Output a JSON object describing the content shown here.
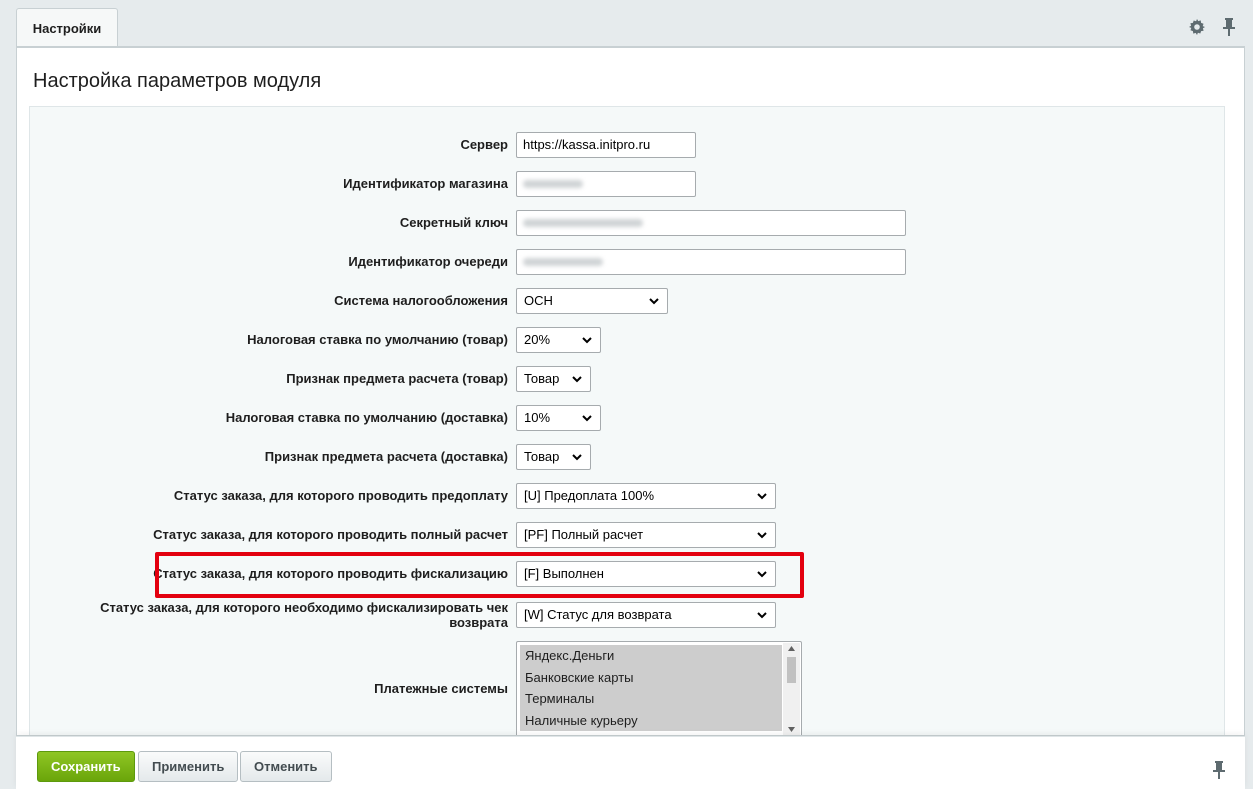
{
  "tab": {
    "label": "Настройки"
  },
  "top_icons": [
    "gear-icon",
    "pin-icon"
  ],
  "title": "Настройка параметров модуля",
  "fields": {
    "server": {
      "label": "Сервер",
      "value": "https://kassa.initpro.ru"
    },
    "shop_id": {
      "label": "Идентификатор магазина"
    },
    "secret_key": {
      "label": "Секретный ключ"
    },
    "queue_id": {
      "label": "Идентификатор очереди"
    },
    "tax_system": {
      "label": "Система налогообложения",
      "value": "ОСН"
    },
    "tax_rate_item": {
      "label": "Налоговая ставка по умолчанию (товар)",
      "value": "20%"
    },
    "subject_item": {
      "label": "Признак предмета расчета (товар)",
      "value": "Товар"
    },
    "tax_rate_delivery": {
      "label": "Налоговая ставка по умолчанию (доставка)",
      "value": "10%"
    },
    "subject_delivery": {
      "label": "Признак предмета расчета (доставка)",
      "value": "Товар"
    },
    "status_prepay": {
      "label": "Статус заказа, для которого проводить предоплату",
      "value": "[U] Предоплата 100%"
    },
    "status_full": {
      "label": "Статус заказа, для которого проводить полный расчет",
      "value": "[PF] Полный расчет"
    },
    "status_fiscal": {
      "label": "Статус заказа, для которого проводить фискализацию",
      "value": "[F] Выполнен"
    },
    "status_return": {
      "label_line1": "Статус заказа, для которого необходимо фискализировать чек",
      "label_line2": "возврата",
      "value": "[W] Статус для возврата"
    },
    "payment_systems": {
      "label": "Платежные системы",
      "options": [
        "Яндекс.Деньги",
        "Банковские карты",
        "Терминалы",
        "Наличные курьеру"
      ]
    }
  },
  "buttons": {
    "save": "Сохранить",
    "apply": "Применить",
    "cancel": "Отменить"
  },
  "colors": {
    "highlight": "#e3000f",
    "save": "#7ab317"
  }
}
